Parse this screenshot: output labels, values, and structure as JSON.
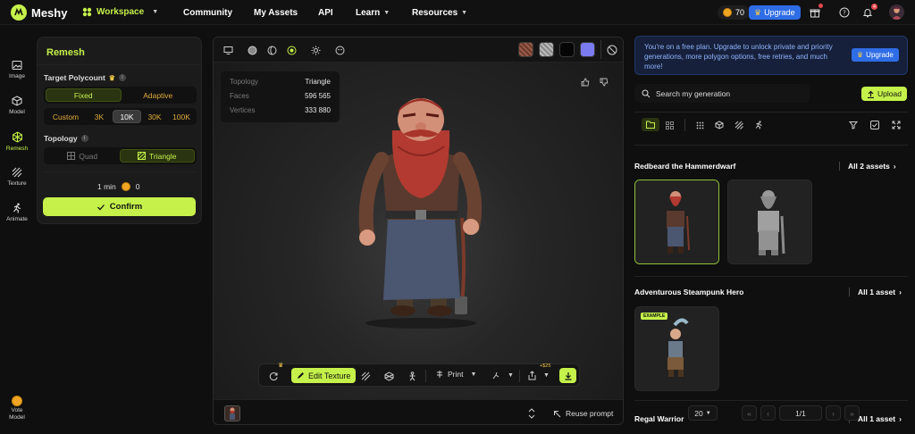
{
  "app": {
    "name": "Meshy"
  },
  "nav": {
    "workspace": "Workspace",
    "community": "Community",
    "my_assets": "My Assets",
    "api": "API",
    "learn": "Learn",
    "resources": "Resources"
  },
  "header": {
    "credits": "70",
    "upgrade": "Upgrade",
    "notification_badge": "4"
  },
  "rail": [
    {
      "label": "Image",
      "icon": "image-icon"
    },
    {
      "label": "Model",
      "icon": "cube-icon"
    },
    {
      "label": "Remesh",
      "icon": "remesh-icon"
    },
    {
      "label": "Texture",
      "icon": "texture-icon"
    },
    {
      "label": "Animate",
      "icon": "run-icon"
    }
  ],
  "vote": {
    "line1": "Vote",
    "line2": "Model"
  },
  "remesh": {
    "title": "Remesh",
    "polycount_label": "Target Polycount",
    "mode_options": [
      "Fixed",
      "Adaptive"
    ],
    "mode_selected": "Fixed",
    "count_options": [
      "Custom",
      "3K",
      "10K",
      "30K",
      "100K"
    ],
    "count_selected": "10K",
    "topology_label": "Topology",
    "topology_options": [
      "Quad",
      "Triangle"
    ],
    "topology_selected": "Triangle",
    "time": "1 min",
    "cost": "0",
    "confirm": "Confirm"
  },
  "stats": {
    "topology_k": "Topology",
    "topology_v": "Triangle",
    "faces_k": "Faces",
    "faces_v": "596 565",
    "vertices_k": "Vertices",
    "vertices_v": "333 880"
  },
  "viewport_toolbar": {
    "edit_texture": "Edit Texture",
    "print": "Print",
    "cost_badge": "+$25",
    "reuse_prompt": "Reuse prompt"
  },
  "colors": {
    "accent": "#c5f14a",
    "blue": "#2f6de6"
  },
  "right": {
    "promo": "You're on a free plan. Upgrade to unlock private and priority generations, more polygon options, free retries, and much more!",
    "promo_button": "Upgrade",
    "search_placeholder": "Search my generation",
    "upload": "Upload",
    "groups": [
      {
        "title": "Redbeard the Hammerdwarf",
        "count": "All 2 assets"
      },
      {
        "title": "Adventurous Steampunk Hero",
        "count": "All 1 asset",
        "badge": "EXAMPLE"
      },
      {
        "title": "Regal Warrior",
        "count": "All 1 asset"
      }
    ],
    "pager": {
      "per_page": "20",
      "page": "1/1"
    }
  }
}
